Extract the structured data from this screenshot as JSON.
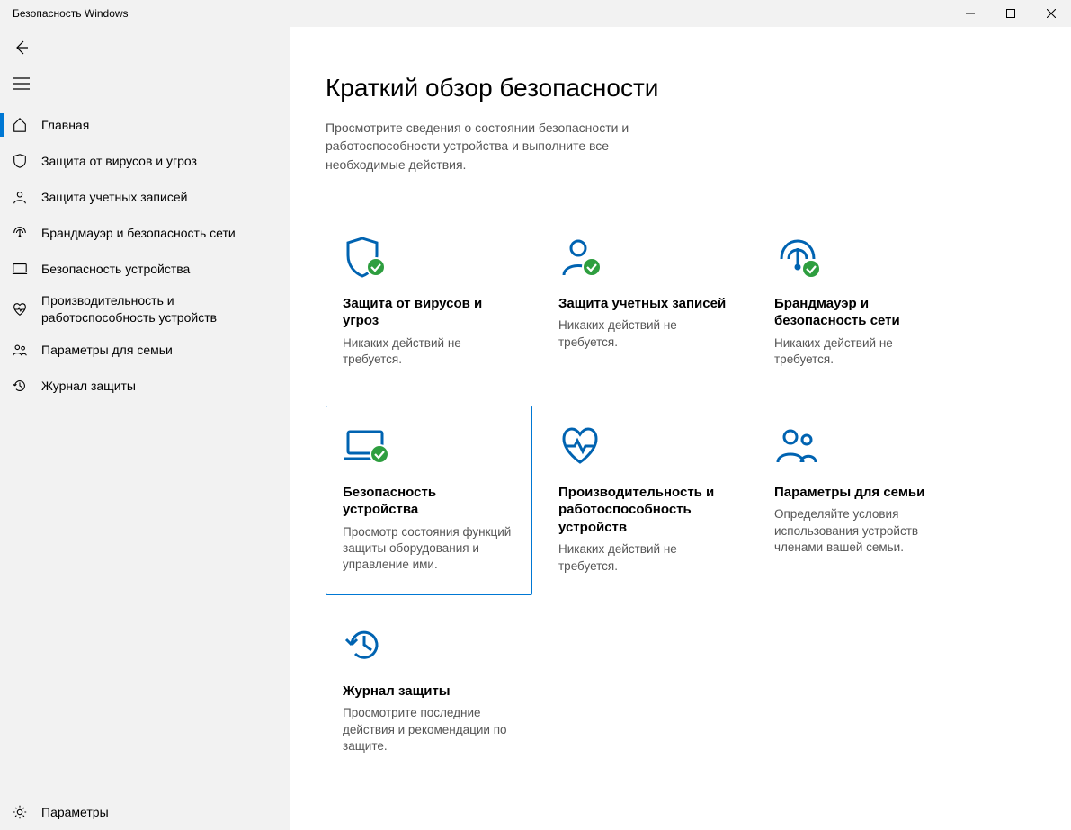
{
  "window": {
    "title": "Безопасность Windows"
  },
  "sidebar": {
    "items": [
      {
        "label": "Главная"
      },
      {
        "label": "Защита от вирусов и угроз"
      },
      {
        "label": "Защита учетных записей"
      },
      {
        "label": "Брандмауэр и безопасность сети"
      },
      {
        "label": "Безопасность устройства"
      },
      {
        "label": "Производительность и работоспособность устройств"
      },
      {
        "label": "Параметры для семьи"
      },
      {
        "label": "Журнал защиты"
      }
    ],
    "settings_label": "Параметры"
  },
  "page": {
    "title": "Краткий обзор безопасности",
    "description": "Просмотрите сведения о состоянии безопасности и работоспособности устройства и выполните все необходимые действия."
  },
  "tiles": [
    {
      "title": "Защита от вирусов и угроз",
      "desc": "Никаких действий не требуется."
    },
    {
      "title": "Защита учетных записей",
      "desc": "Никаких действий не требуется."
    },
    {
      "title": "Брандмауэр и безопасность сети",
      "desc": "Никаких действий не требуется."
    },
    {
      "title": "Безопасность устройства",
      "desc": "Просмотр состояния функций защиты оборудования и управление ими."
    },
    {
      "title": "Производительность и работоспособность устройств",
      "desc": "Никаких действий не требуется."
    },
    {
      "title": "Параметры для семьи",
      "desc": "Определяйте условия использования устройств членами вашей семьи."
    },
    {
      "title": "Журнал защиты",
      "desc": "Просмотрите последние действия и рекомендации по защите."
    }
  ]
}
